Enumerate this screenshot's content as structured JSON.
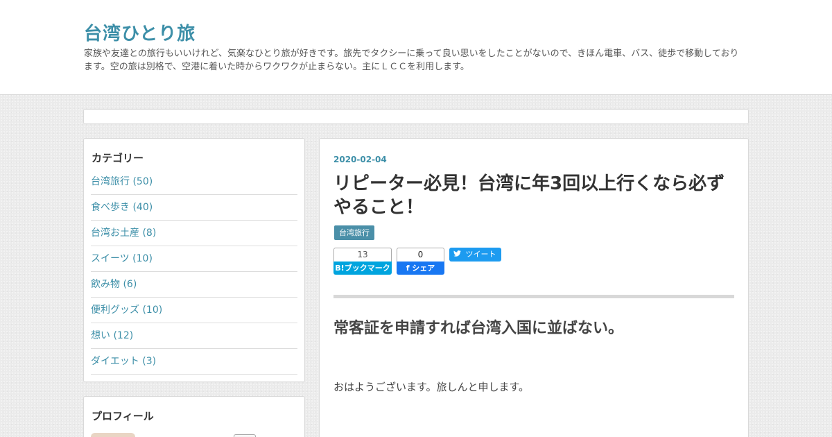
{
  "header": {
    "blog_title": "台湾ひとり旅",
    "description": "家族や友達との旅行もいいけれど、気楽なひとり旅が好きです。旅先でタクシーに乗って良い思いをしたことがないので、きほん電車、バス、徒歩で移動しております。空の旅は別格で、空港に着いた時からワクワクが止まらない。主にＬＣＣを利用します。"
  },
  "sidebar": {
    "categories_title": "カテゴリー",
    "categories": [
      {
        "label": "台湾旅行 (50)"
      },
      {
        "label": "食べ歩き (40)"
      },
      {
        "label": "台湾お土産 (8)"
      },
      {
        "label": "スイーツ (10)"
      },
      {
        "label": "飲み物 (6)"
      },
      {
        "label": "便利グッズ (10)"
      },
      {
        "label": "想い (12)"
      },
      {
        "label": "ダイエット (3)"
      }
    ],
    "profile_title": "プロフィール"
  },
  "post": {
    "date": "2020-02-04",
    "title": "リピーター必見！台湾に年3回以上行くなら必ずやること！",
    "category": "台湾旅行",
    "share": {
      "hatena_count": "13",
      "hatena_label": "B!ブックマーク",
      "fb_count": "0",
      "fb_label": "f シェア",
      "tweet_label": "ツイート"
    },
    "heading": "常客証を申請すれば台湾入国に並ばない。",
    "paragraph": "おはようございます。旅しんと申します。"
  },
  "colors": {
    "accent": "#3d8fa8",
    "hatena": "#00a4de",
    "facebook": "#1877f2",
    "twitter": "#1d9bf0"
  }
}
